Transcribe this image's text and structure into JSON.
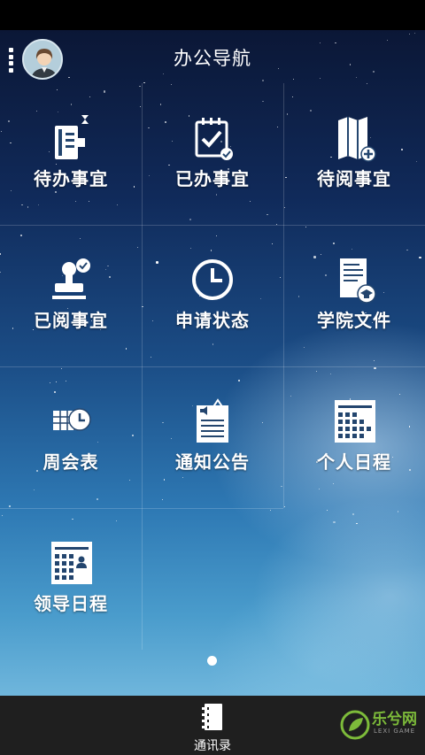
{
  "header": {
    "title": "办公导航",
    "menu_icon": "vertical-dots-icon",
    "avatar_icon": "user-avatar-icon"
  },
  "grid": {
    "items": [
      {
        "label": "待办事宜",
        "icon": "notebook-hourglass-icon"
      },
      {
        "label": "已办事宜",
        "icon": "calendar-check-icon"
      },
      {
        "label": "待阅事宜",
        "icon": "map-plus-icon"
      },
      {
        "label": "已阅事宜",
        "icon": "stamp-check-icon"
      },
      {
        "label": "申请状态",
        "icon": "clock-icon"
      },
      {
        "label": "学院文件",
        "icon": "document-graduation-icon"
      },
      {
        "label": "周会表",
        "icon": "table-clock-icon"
      },
      {
        "label": "通知公告",
        "icon": "announcement-document-icon"
      },
      {
        "label": "个人日程",
        "icon": "schedule-grid-icon"
      },
      {
        "label": "领导日程",
        "icon": "leader-schedule-icon"
      }
    ]
  },
  "pager": {
    "current_page": 1,
    "total_pages": 1
  },
  "bottom": {
    "contacts_label": "通讯录",
    "contacts_icon": "address-book-icon"
  },
  "watermark": {
    "text": "乐兮网",
    "sub": "LEXI GAME"
  },
  "colors": {
    "status_bar": "#000000",
    "bottom_bar": "#1f1f1f",
    "text": "#ffffff",
    "watermark_green": "#7dbb3a"
  }
}
